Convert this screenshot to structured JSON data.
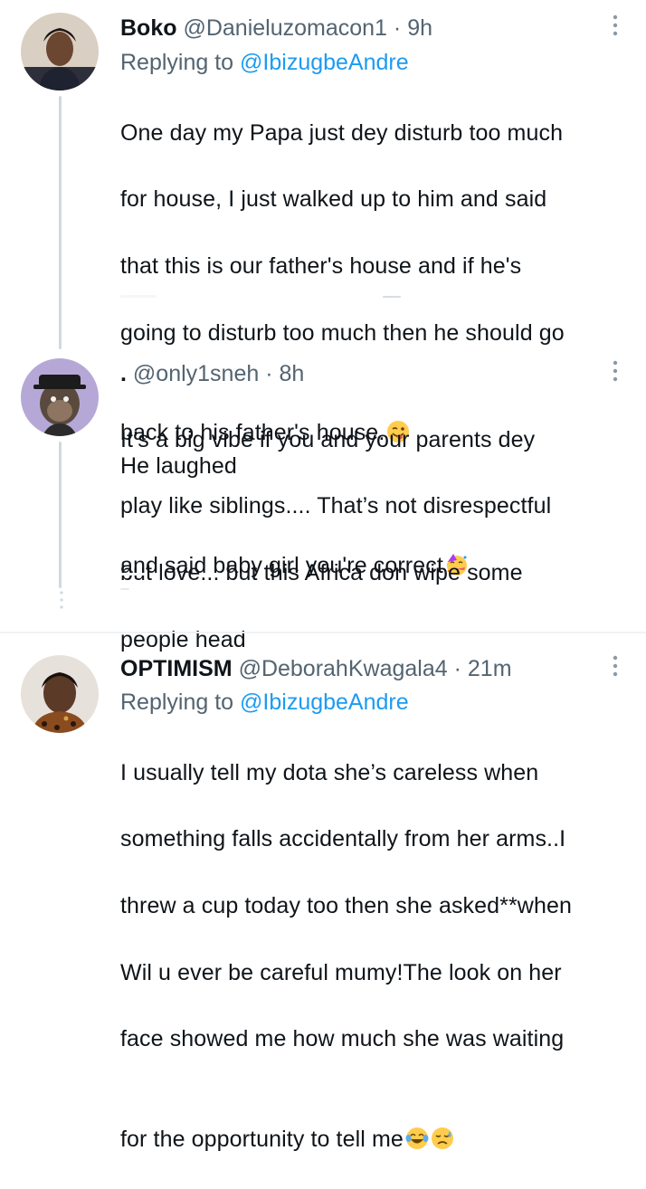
{
  "tweets": [
    {
      "display_name": "Boko",
      "handle": "@Danieluzomacon1",
      "separator": "·",
      "time": "9h",
      "replying_label": "Replying to",
      "replying_to": "@IbizugbeAndre",
      "text_lines": [
        "One day my Papa just dey disturb too much",
        "for house, I just walked up to him and said",
        "that this is our father's house and if he's",
        "going to disturb too much then he should go",
        "back to his father's house.",
        "He laughed",
        "and said baby girl you're correct"
      ],
      "emojis": [
        "winking-face-with-tongue",
        "partying-face"
      ]
    },
    {
      "display_name": ".",
      "handle": "@only1sneh",
      "separator": "·",
      "time": "8h",
      "text_lines": [
        "It’s a big vibe if you and your parents dey",
        "play like siblings.... That’s not disrespectful",
        "but love... but this Africa don wipe some",
        "people head"
      ]
    },
    {
      "display_name": "OPTIMISM",
      "handle": "@DeborahKwagala4",
      "separator": "·",
      "time": "21m",
      "replying_label": "Replying to",
      "replying_to": "@IbizugbeAndre",
      "text_lines": [
        "I usually tell my dota she’s careless when",
        "something falls accidentally from her arms..I",
        "threw a cup today too then she asked**when",
        "Wil u ever be careful mumy!The look on her",
        "face showed me how much she was waiting",
        "for the opportunity to tell me"
      ],
      "emojis": [
        "face-with-tears-of-joy",
        "disappointed-relieved-face"
      ]
    }
  ],
  "colors": {
    "text": "#0f1419",
    "meta": "#536471",
    "mention": "#1d9bf0",
    "thread_line": "#cfd9de",
    "divider": "#eff3f4"
  }
}
